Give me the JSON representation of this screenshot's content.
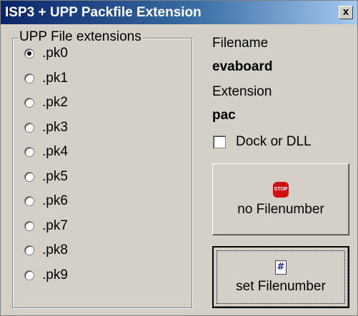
{
  "window": {
    "title": "ISP3 + UPP Packfile Extension",
    "close_glyph": "x"
  },
  "group": {
    "legend": "UPP File extensions",
    "options": [
      ".pk0",
      ".pk1",
      ".pk2",
      ".pk3",
      ".pk4",
      ".pk5",
      ".pk6",
      ".pk7",
      ".pk8",
      ".pk9"
    ],
    "selected": ".pk0"
  },
  "info": {
    "filename_label": "Filename",
    "filename_value": "evaboard",
    "extension_label": "Extension",
    "extension_value": "pac"
  },
  "dock_checkbox": {
    "label": "Dock or DLL",
    "checked": false
  },
  "buttons": {
    "no_filenumber": {
      "label": "no Filenumber",
      "icon": "stop-icon",
      "icon_text": "STOP"
    },
    "set_filenumber": {
      "label": "set Filenumber",
      "icon": "hash-document-icon",
      "icon_text": "#"
    }
  },
  "colors": {
    "title_start": "#0a246a",
    "title_end": "#a6caf0",
    "face": "#d4d0c8",
    "stop_red": "#d01010"
  }
}
